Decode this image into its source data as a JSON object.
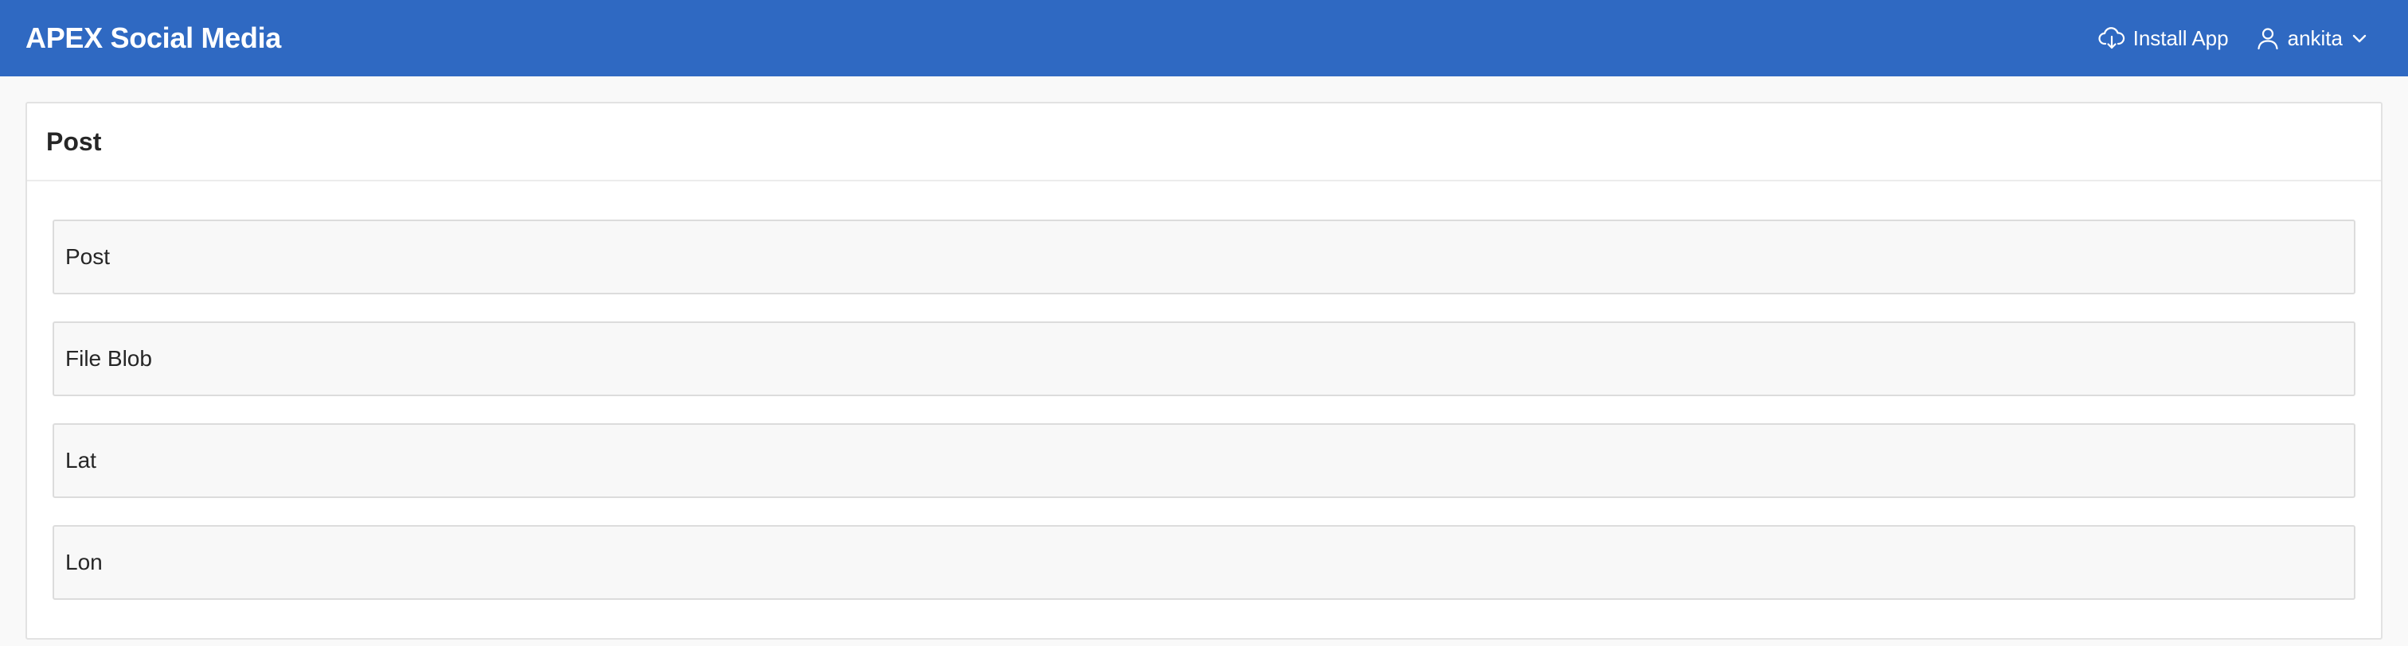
{
  "header": {
    "app_title": "APEX Social Media",
    "install_label": "Install App",
    "install_icon": "cloud-download-icon",
    "user_name": "ankita",
    "user_icon": "user-icon",
    "chevron_icon": "chevron-down-icon",
    "background_color": "#2f69c2"
  },
  "region": {
    "title": "Post",
    "fields": [
      {
        "label": "Post"
      },
      {
        "label": "File Blob"
      },
      {
        "label": "Lat"
      },
      {
        "label": "Lon"
      }
    ]
  }
}
